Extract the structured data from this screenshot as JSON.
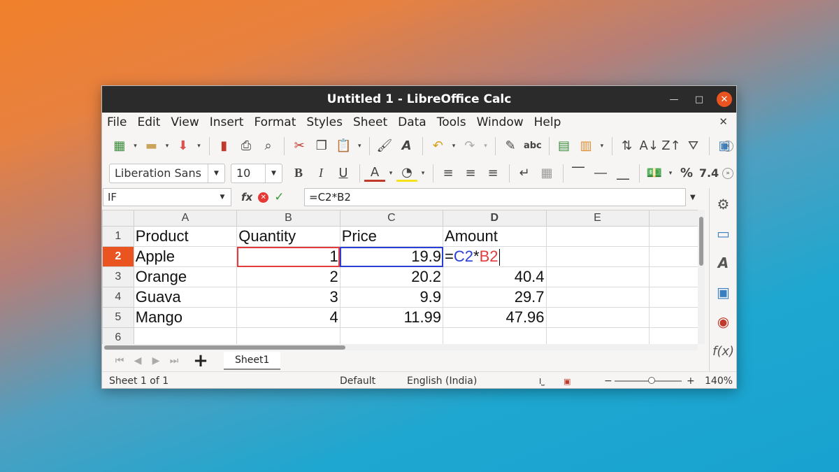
{
  "window": {
    "title": "Untitled 1 - LibreOffice Calc"
  },
  "menu": [
    "File",
    "Edit",
    "View",
    "Insert",
    "Format",
    "Styles",
    "Sheet",
    "Data",
    "Tools",
    "Window",
    "Help"
  ],
  "format_toolbar": {
    "font_name": "Liberation Sans",
    "font_size": "10",
    "number_format_label": "7.4"
  },
  "formula_bar": {
    "name_box": "IF",
    "formula": "=C2*B2"
  },
  "columns": [
    "A",
    "B",
    "C",
    "D",
    "E"
  ],
  "active_column": "D",
  "rows": [
    {
      "num": "1",
      "a": "Product",
      "b": "Quantity",
      "c": "Price",
      "d": "Amount"
    },
    {
      "num": "2",
      "a": "Apple",
      "b": "1",
      "c": "19.9",
      "d_ref1_prefix": "=",
      "d_ref1": "C2",
      "d_op": "*",
      "d_ref2": "B2"
    },
    {
      "num": "3",
      "a": "Orange",
      "b": "2",
      "c": "20.2",
      "d": "40.4"
    },
    {
      "num": "4",
      "a": "Guava",
      "b": "3",
      "c": "9.9",
      "d": "29.7"
    },
    {
      "num": "5",
      "a": "Mango",
      "b": "4",
      "c": "11.99",
      "d": "47.96"
    },
    {
      "num": "6",
      "a": "",
      "b": "",
      "c": "",
      "d": ""
    }
  ],
  "active_row": "2",
  "sheet_tabs": [
    "Sheet1"
  ],
  "status": {
    "sheet": "Sheet 1 of 1",
    "page_style": "Default",
    "language": "English (India)",
    "zoom": "140%",
    "zoom_minus": "−",
    "zoom_plus": "+"
  },
  "accent_color": "#e95420"
}
